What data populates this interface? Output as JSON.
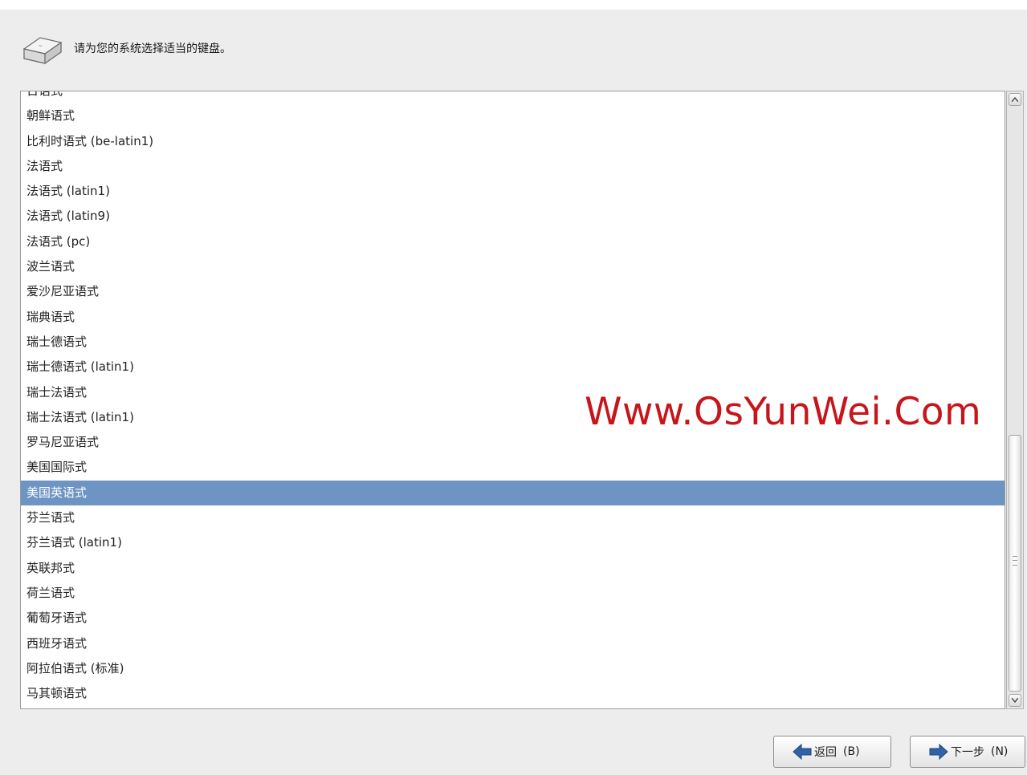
{
  "header": {
    "text": "请为您的系统选择适当的键盘。",
    "icon": "keyboard-key-icon"
  },
  "keyboard_list": {
    "items": [
      {
        "label": "日语式"
      },
      {
        "label": "朝鲜语式"
      },
      {
        "label": "比利时语式 (be-latin1)"
      },
      {
        "label": "法语式"
      },
      {
        "label": "法语式 (latin1)"
      },
      {
        "label": "法语式 (latin9)"
      },
      {
        "label": "法语式 (pc)"
      },
      {
        "label": "波兰语式"
      },
      {
        "label": "爱沙尼亚语式"
      },
      {
        "label": "瑞典语式"
      },
      {
        "label": "瑞士德语式"
      },
      {
        "label": "瑞士德语式 (latin1)"
      },
      {
        "label": "瑞士法语式"
      },
      {
        "label": "瑞士法语式 (latin1)"
      },
      {
        "label": "罗马尼亚语式"
      },
      {
        "label": "美国国际式"
      },
      {
        "label": "美国英语式"
      },
      {
        "label": "芬兰语式"
      },
      {
        "label": "芬兰语式 (latin1)"
      },
      {
        "label": "英联邦式"
      },
      {
        "label": "荷兰语式"
      },
      {
        "label": "葡萄牙语式"
      },
      {
        "label": "西班牙语式"
      },
      {
        "label": "阿拉伯语式 (标准)"
      },
      {
        "label": "马其顿语式"
      }
    ],
    "selected": "美国英语式"
  },
  "watermark": "Www.OsYunWei.Com",
  "buttons": {
    "back": {
      "label": "返回",
      "shortcut": "(B)",
      "icon": "arrow-left-icon"
    },
    "next": {
      "label": "下一步",
      "shortcut": "(N)",
      "icon": "arrow-right-icon"
    }
  },
  "colors": {
    "selection": "#6d94c2",
    "watermark": "#c6161c",
    "arrow": "#3b6fb0"
  }
}
